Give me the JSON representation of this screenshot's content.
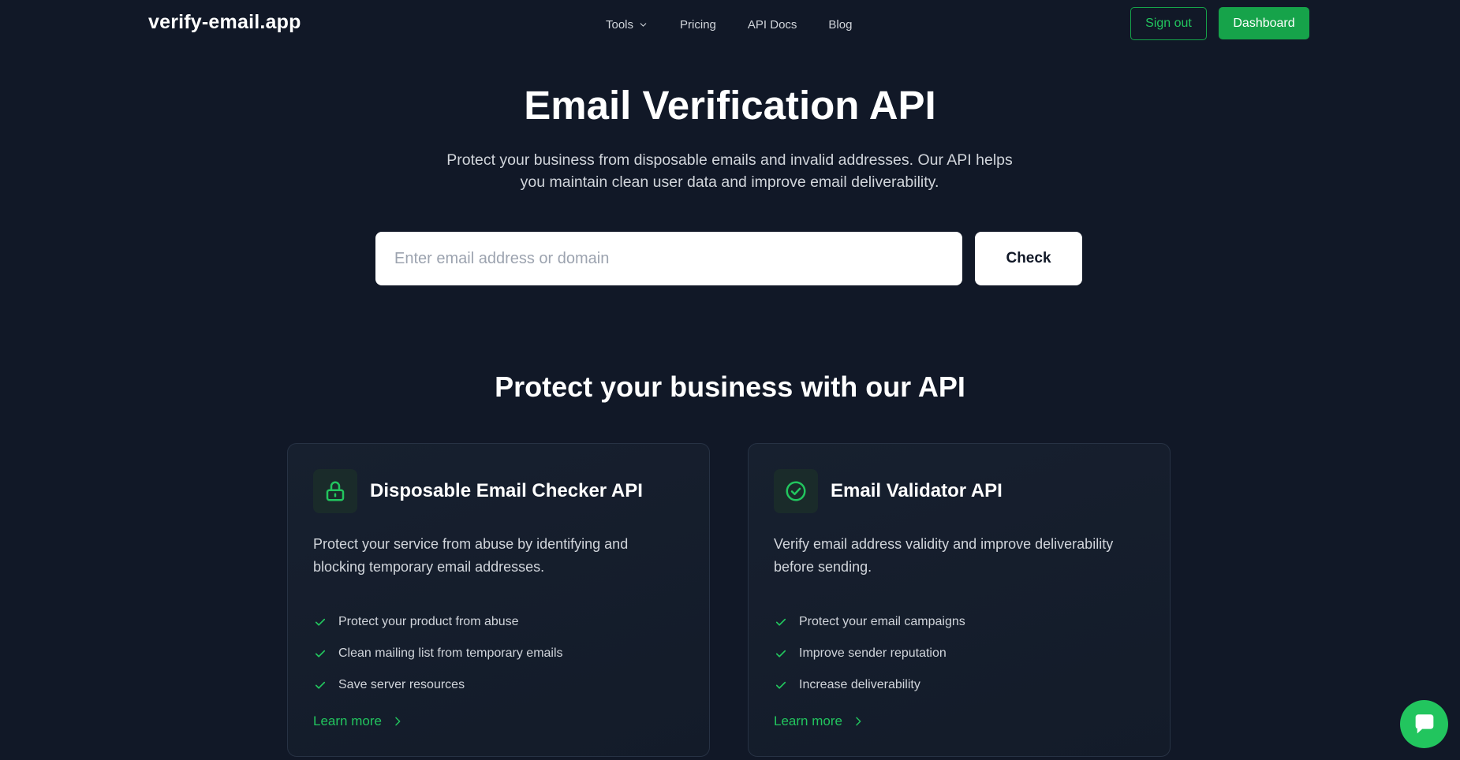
{
  "header": {
    "logo": "verify-email.app",
    "nav": [
      {
        "label": "Tools",
        "has_dropdown": true
      },
      {
        "label": "Pricing"
      },
      {
        "label": "API Docs"
      },
      {
        "label": "Blog"
      }
    ],
    "sign_out_label": "Sign out",
    "dashboard_label": "Dashboard"
  },
  "hero": {
    "title": "Email Verification API",
    "subtitle": "Protect your business from disposable emails and invalid addresses. Our API helps you maintain clean user data and improve email deliverability.",
    "search_placeholder": "Enter email address or domain",
    "search_value": "",
    "check_label": "Check"
  },
  "section": {
    "title": "Protect your business with our API",
    "cards": [
      {
        "icon": "lock-icon",
        "title": "Disposable Email Checker API",
        "description": "Protect your service from abuse by identifying and blocking temporary email addresses.",
        "features": [
          "Protect your product from abuse",
          "Clean mailing list from temporary emails",
          "Save server resources"
        ],
        "link_label": "Learn more"
      },
      {
        "icon": "check-circle-icon",
        "title": "Email Validator API",
        "description": "Verify email address validity and improve deliverability before sending.",
        "features": [
          "Protect your email campaigns",
          "Improve sender reputation",
          "Increase deliverability"
        ],
        "link_label": "Learn more"
      }
    ]
  },
  "colors": {
    "background": "#111827",
    "accent": "#16a34a",
    "accent_light": "#22c55e",
    "text": "#ffffff",
    "muted_text": "#d1d5db"
  }
}
